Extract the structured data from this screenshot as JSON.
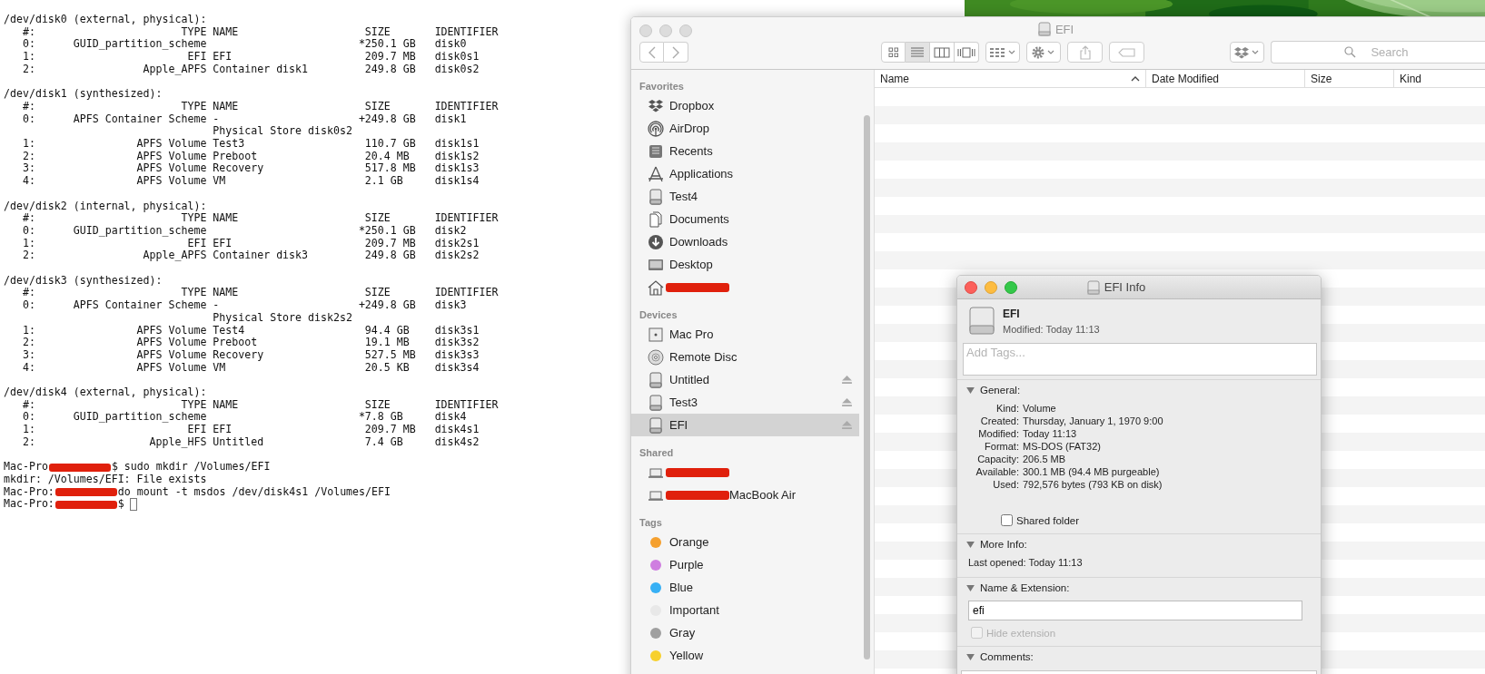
{
  "terminal": {
    "blocks": [
      {
        "header": "/dev/disk0 (external, physical):",
        "lines": [
          "   #:                       TYPE NAME                    SIZE       IDENTIFIER",
          "   0:      GUID_partition_scheme                        *250.1 GB   disk0",
          "   1:                        EFI EFI                     209.7 MB   disk0s1",
          "   2:                 Apple_APFS Container disk1         249.8 GB   disk0s2"
        ]
      },
      {
        "header": "/dev/disk1 (synthesized):",
        "lines": [
          "   #:                       TYPE NAME                    SIZE       IDENTIFIER",
          "   0:      APFS Container Scheme -                      +249.8 GB   disk1",
          "                                 Physical Store disk0s2",
          "   1:                APFS Volume Test3                   110.7 GB   disk1s1",
          "   2:                APFS Volume Preboot                 20.4 MB    disk1s2",
          "   3:                APFS Volume Recovery                517.8 MB   disk1s3",
          "   4:                APFS Volume VM                      2.1 GB     disk1s4"
        ]
      },
      {
        "header": "/dev/disk2 (internal, physical):",
        "lines": [
          "   #:                       TYPE NAME                    SIZE       IDENTIFIER",
          "   0:      GUID_partition_scheme                        *250.1 GB   disk2",
          "   1:                        EFI EFI                     209.7 MB   disk2s1",
          "   2:                 Apple_APFS Container disk3         249.8 GB   disk2s2"
        ]
      },
      {
        "header": "/dev/disk3 (synthesized):",
        "lines": [
          "   #:                       TYPE NAME                    SIZE       IDENTIFIER",
          "   0:      APFS Container Scheme -                      +249.8 GB   disk3",
          "                                 Physical Store disk2s2",
          "   1:                APFS Volume Test4                   94.4 GB    disk3s1",
          "   2:                APFS Volume Preboot                 19.1 MB    disk3s2",
          "   3:                APFS Volume Recovery                527.5 MB   disk3s3",
          "   4:                APFS Volume VM                      20.5 KB    disk3s4"
        ]
      },
      {
        "header": "/dev/disk4 (external, physical):",
        "lines": [
          "   #:                       TYPE NAME                    SIZE       IDENTIFIER",
          "   0:      GUID_partition_scheme                        *7.8 GB     disk4",
          "   1:                        EFI EFI                     209.7 MB   disk4s1",
          "   2:                  Apple_HFS Untitled                7.4 GB     disk4s2"
        ]
      }
    ],
    "session": [
      {
        "kind": "prompt",
        "prefix": "Mac-Pro",
        "suffix": "$ sudo mkdir /Volumes/EFI"
      },
      {
        "kind": "output",
        "text": "mkdir: /Volumes/EFI: File exists"
      },
      {
        "kind": "prompt",
        "prefix": "Mac-Pro:",
        "suffix": "do mount -t msdos /dev/disk4s1 /Volumes/EFI"
      },
      {
        "kind": "prompt",
        "prefix": "Mac-Pro:",
        "suffix": "$",
        "cursor": true
      }
    ]
  },
  "finder": {
    "title": "EFI",
    "views": [
      {
        "kind": "icons",
        "selected": false
      },
      {
        "kind": "list",
        "selected": true
      },
      {
        "kind": "columns",
        "selected": false
      },
      {
        "kind": "coverflow",
        "selected": false
      }
    ],
    "search": {
      "placeholder": "Search"
    },
    "sidebar": [
      {
        "heading": "Favorites",
        "items": [
          {
            "kind": "dropbox",
            "label": "Dropbox",
            "selected": false
          },
          {
            "kind": "airdrop",
            "label": "AirDrop",
            "selected": false
          },
          {
            "kind": "recents",
            "label": "Recents",
            "selected": false
          },
          {
            "kind": "applications",
            "label": "Applications",
            "selected": false
          },
          {
            "kind": "drive",
            "label": "Test4",
            "selected": false
          },
          {
            "kind": "documents",
            "label": "Documents",
            "selected": false
          },
          {
            "kind": "downloads",
            "label": "Downloads",
            "selected": false
          },
          {
            "kind": "desktop",
            "label": "Desktop",
            "selected": false
          },
          {
            "kind": "home",
            "selected": false,
            "redacted": true
          }
        ]
      },
      {
        "heading": "Devices",
        "items": [
          {
            "kind": "computer",
            "label": "Mac Pro",
            "selected": false
          },
          {
            "kind": "disc",
            "label": "Remote Disc",
            "selected": false
          },
          {
            "kind": "drive",
            "label": "Untitled",
            "selected": false,
            "ejectable": true
          },
          {
            "kind": "drive",
            "label": "Test3",
            "selected": false,
            "ejectable": true
          },
          {
            "kind": "drive",
            "label": "EFI",
            "selected": true,
            "ejectable": true
          }
        ]
      },
      {
        "heading": "Shared",
        "items": [
          {
            "kind": "laptop",
            "selected": false,
            "redacted": true
          },
          {
            "kind": "laptop",
            "label": "MacBook Air",
            "selected": false,
            "redacted": true
          }
        ]
      },
      {
        "heading": "Tags",
        "items": [
          {
            "kind": "tag",
            "label": "Orange",
            "color": "#f5a02e",
            "selected": false
          },
          {
            "kind": "tag",
            "label": "Purple",
            "color": "#cf7ee0",
            "selected": false
          },
          {
            "kind": "tag",
            "label": "Blue",
            "color": "#37b0f5",
            "selected": false
          },
          {
            "kind": "tag",
            "label": "Important",
            "color": "#e8e8e8",
            "selected": false
          },
          {
            "kind": "tag",
            "label": "Gray",
            "color": "#a0a0a0",
            "selected": false
          },
          {
            "kind": "tag",
            "label": "Yellow",
            "color": "#f7d02c",
            "selected": false
          }
        ]
      }
    ],
    "columns": [
      {
        "label": "Name",
        "sorted": true
      },
      {
        "label": "Date Modified",
        "sorted": false
      },
      {
        "label": "Size",
        "sorted": false
      },
      {
        "label": "Kind",
        "sorted": false
      }
    ]
  },
  "info": {
    "title": "EFI Info",
    "name": "EFI",
    "modified": "Modified: Today 11:13",
    "tags": {
      "placeholder": "Add Tags..."
    },
    "sections": [
      {
        "kind": "general",
        "heading": "General:",
        "expanded": true,
        "rows": [
          {
            "label": "Kind:",
            "value": "Volume"
          },
          {
            "label": "Created:",
            "value": "Thursday, January 1, 1970 9:00"
          },
          {
            "label": "Modified:",
            "value": "Today 11:13"
          },
          {
            "label": "Format:",
            "value": "MS-DOS (FAT32)"
          },
          {
            "label": "Capacity:",
            "value": "206.5 MB"
          },
          {
            "label": "Available:",
            "value": "300.1 MB (94.4 MB purgeable)"
          },
          {
            "label": "Used:",
            "value": "792,576 bytes (793 KB on disk)"
          }
        ],
        "checkbox": {
          "label": "Shared folder",
          "checked": false,
          "disabled": false
        }
      },
      {
        "kind": "more",
        "heading": "More Info:",
        "expanded": true,
        "text": "Last opened: Today 11:13"
      },
      {
        "kind": "name",
        "heading": "Name & Extension:",
        "expanded": true,
        "value": "efi",
        "checkbox": {
          "label": "Hide extension",
          "checked": false,
          "disabled": true
        }
      },
      {
        "kind": "comments",
        "heading": "Comments:",
        "expanded": true
      }
    ]
  }
}
